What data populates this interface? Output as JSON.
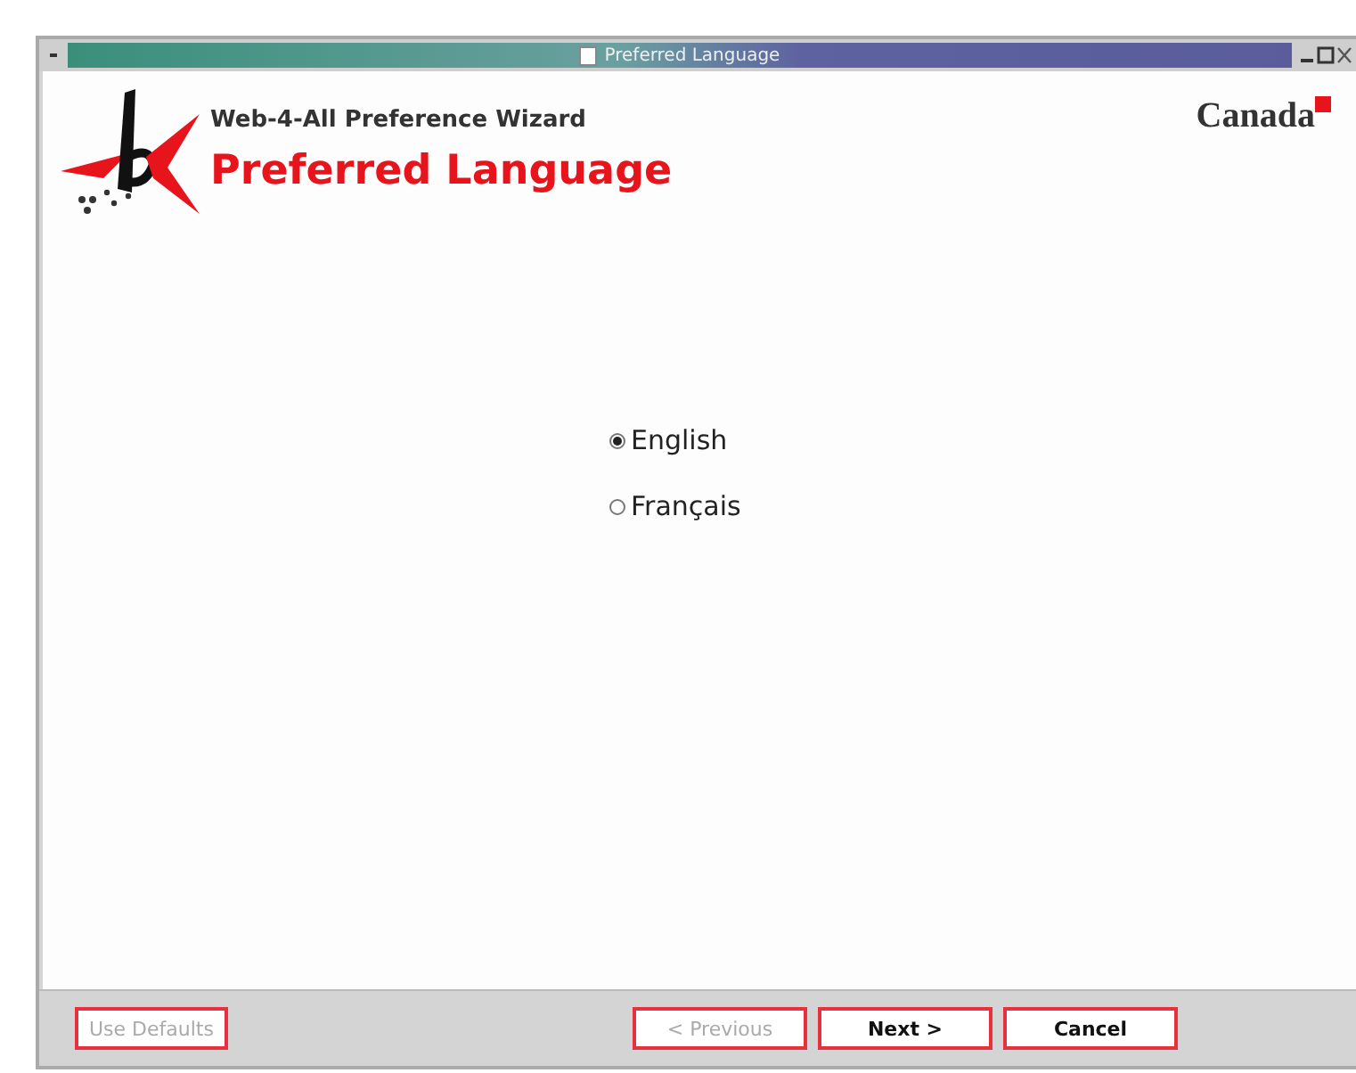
{
  "window": {
    "title": "Preferred Language"
  },
  "header": {
    "subtitle": "Web-4-All Preference Wizard",
    "title": "Preferred Language",
    "brand": "Canada"
  },
  "options": [
    {
      "label": "English",
      "selected": true
    },
    {
      "label": "Français",
      "selected": false
    }
  ],
  "left_buttons": [
    {
      "label": "Use Defaults",
      "disabled": true
    }
  ],
  "right_buttons": [
    {
      "label": "< Previous",
      "disabled": true
    },
    {
      "label": "Next >",
      "disabled": false
    },
    {
      "label": "Cancel",
      "disabled": false
    }
  ]
}
